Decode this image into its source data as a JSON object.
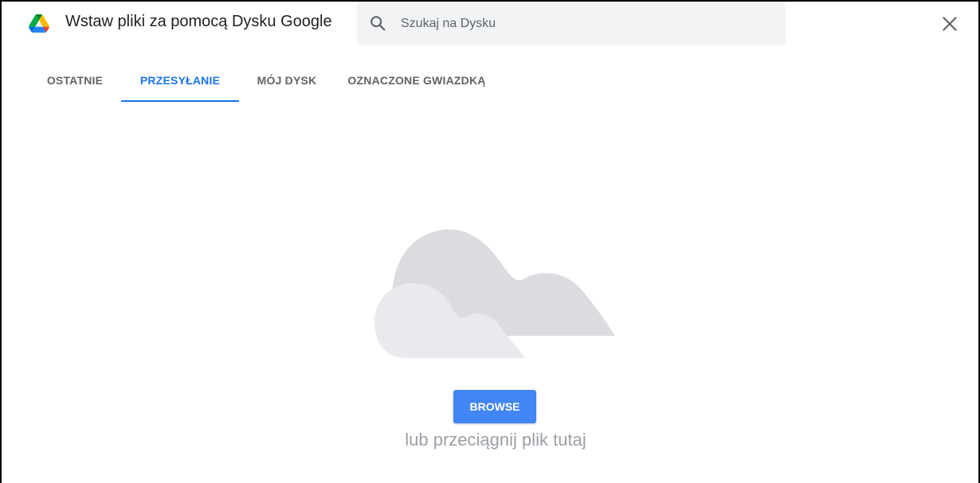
{
  "header": {
    "title": "Wstaw pliki za pomocą Dysku Google",
    "logo_icon": "google-drive-logo-icon",
    "close_icon": "close-icon"
  },
  "search": {
    "placeholder": "Szukaj na Dysku",
    "value": "",
    "icon": "search-icon"
  },
  "tabs": [
    {
      "label": "OSTATNIE",
      "active": false
    },
    {
      "label": "PRZESYŁANIE",
      "active": true
    },
    {
      "label": "MÓJ DYSK",
      "active": false
    },
    {
      "label": "OZNACZONE GWIAZDKĄ",
      "active": false
    }
  ],
  "upload": {
    "illustration_icon": "cloud-upload-illustration",
    "browse_label": "BROWSE",
    "drop_hint": "lub przeciągnij plik tutaj"
  },
  "colors": {
    "accent": "#1a73e8",
    "button": "#4285f4",
    "tab_inactive": "#5f6368",
    "hint_text": "#9aa0a6",
    "cloud_back": "#dadce0",
    "cloud_front": "#e8eaed"
  }
}
